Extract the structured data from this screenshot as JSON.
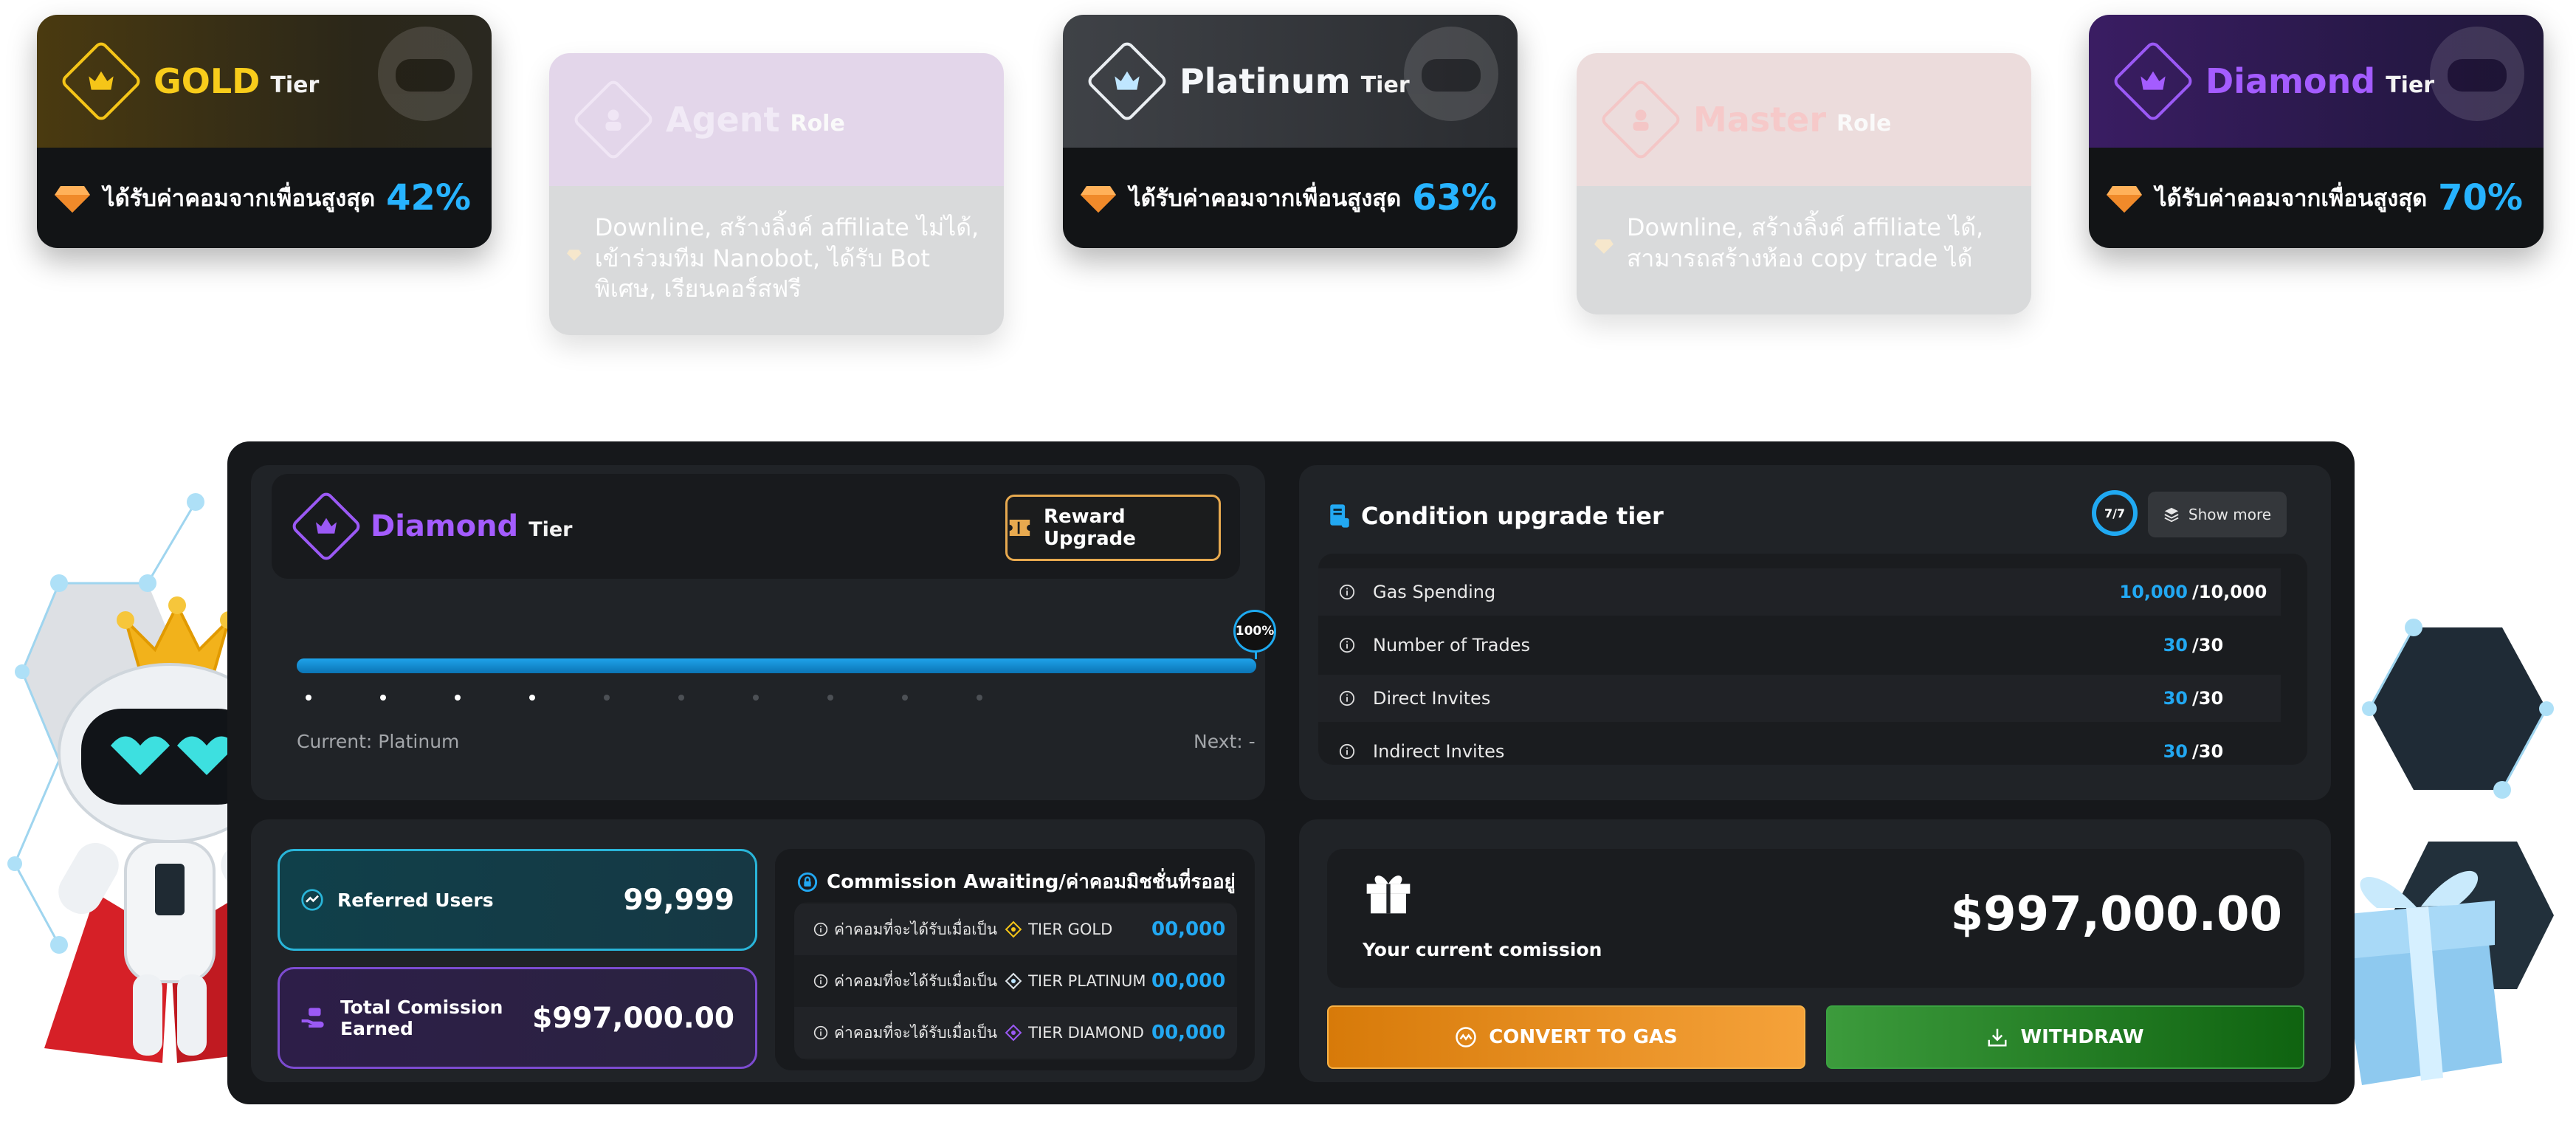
{
  "tier_cards": [
    {
      "name": "GOLD",
      "suffix": "Tier",
      "benefit": "ได้รับค่าคอมจากเพื่อนสูงสุด",
      "percent": "42%"
    },
    {
      "name": "Platinum",
      "suffix": "Tier",
      "benefit": "ได้รับค่าคอมจากเพื่อนสูงสุด",
      "percent": "63%"
    },
    {
      "name": "Diamond",
      "suffix": "Tier",
      "benefit": "ได้รับค่าคอมจากเพื่อนสูงสุด",
      "percent": "70%"
    }
  ],
  "role_cards": [
    {
      "name": "Agent",
      "suffix": "Role",
      "description": "Downline, สร้างลิ้งค์ affiliate ไม่ได้, เข้าร่วมทีม Nanobot, ได้รับ Bot พิเศษ, เรียนคอร์สฟรี"
    },
    {
      "name": "Master",
      "suffix": "Role",
      "description": "Downline, สร้างลิ้งค์ affiliate ได้, สามารถสร้างห้อง copy trade ได้"
    }
  ],
  "current_tier": {
    "name": "Diamond",
    "suffix": "Tier"
  },
  "reward_upgrade_label": "Reward Upgrade",
  "progress": {
    "percent": 100,
    "percent_label": "100%",
    "current_label": "Current: Platinum",
    "next_label": "Next: -",
    "dots_total": 10,
    "dots_done": 4
  },
  "condition": {
    "title": "Condition upgrade tier",
    "ring_label": "7/7",
    "show_more_label": "Show more",
    "rows": [
      {
        "label": "Gas Spending",
        "current": "10,000",
        "max": "/10,000"
      },
      {
        "label": "Number of Trades",
        "current": "30",
        "max": "/30"
      },
      {
        "label": "Direct Invites",
        "current": "30",
        "max": "/30"
      },
      {
        "label": "Indirect Invites",
        "current": "30",
        "max": "/30"
      }
    ]
  },
  "stats": {
    "referred_label": "Referred Users",
    "referred_value": "99,999",
    "total_label": "Total Comission Earned",
    "total_value": "$997,000.00"
  },
  "commission": {
    "title": "Commission Awaiting/ค่าคอมมิชชั่นที่รออยู่",
    "rows": [
      {
        "prefix": "ค่าคอมที่จะได้รับเมื่อเป็น",
        "tier": "TIER GOLD",
        "value": "00,000"
      },
      {
        "prefix": "ค่าคอมที่จะได้รับเมื่อเป็น",
        "tier": "TIER PLATINUM",
        "value": "00,000"
      },
      {
        "prefix": "ค่าคอมที่จะได้รับเมื่อเป็น",
        "tier": "TIER DIAMOND",
        "value": "00,000"
      }
    ]
  },
  "current_commission": {
    "label": "Your current comission",
    "value": "$997,000.00"
  },
  "buttons": {
    "convert": "CONVERT TO GAS",
    "withdraw": "WITHDRAW"
  },
  "colors": {
    "accent_blue": "#22a8f2",
    "gold": "#f8cc1b",
    "diamond": "#a45cff",
    "convert": "#f5a23a",
    "withdraw": "#3c9b3c"
  }
}
